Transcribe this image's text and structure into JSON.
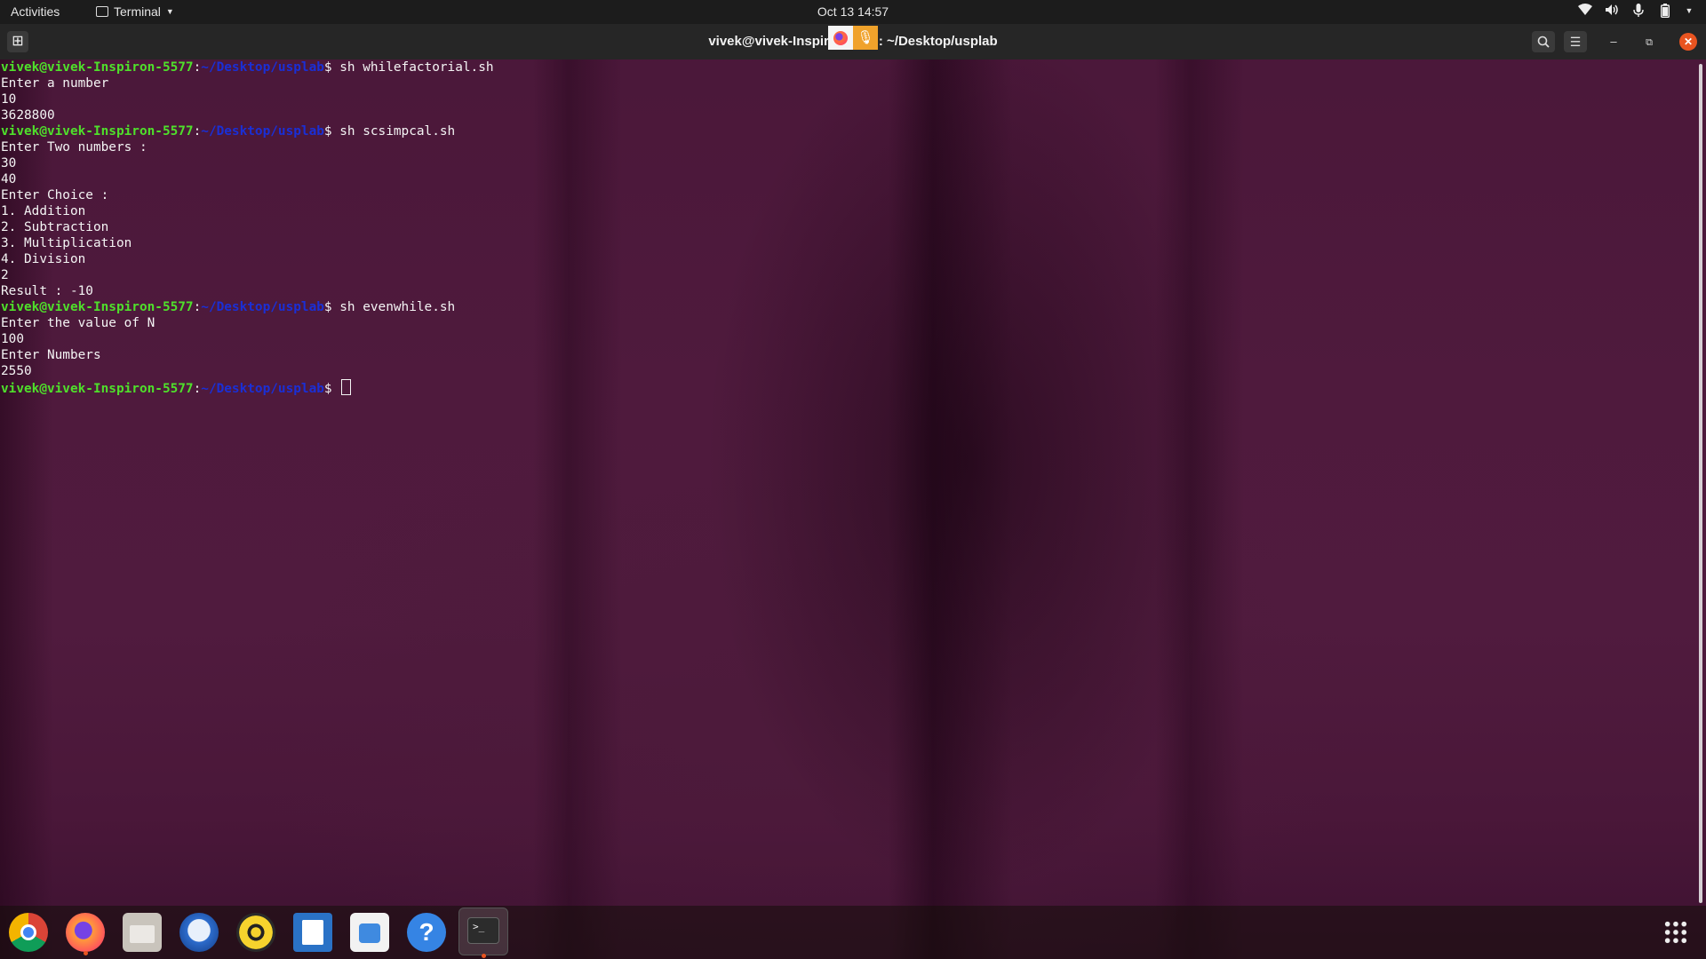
{
  "topbar": {
    "activities": "Activities",
    "app_name": "Terminal",
    "clock": "Oct 13  14:57",
    "tray_icons": [
      "wifi-icon",
      "volume-icon",
      "mic-icon",
      "battery-icon",
      "chevron-down-icon"
    ]
  },
  "window": {
    "title": "vivek@vivek-Inspir",
    "title_suffix": ": ~/Desktop/usplab",
    "accent_close": "#e95420"
  },
  "terminal": {
    "prompt_user": "vivek@vivek-Inspiron-5577",
    "prompt_path": "~/Desktop/usplab",
    "colors": {
      "user": "#4fe02b",
      "path": "#1a2fd6",
      "text": "#f4f4f4"
    },
    "lines": [
      {
        "type": "prompt",
        "cmd": " sh whilefactorial.sh"
      },
      {
        "type": "out",
        "text": "Enter a number"
      },
      {
        "type": "out",
        "text": "10"
      },
      {
        "type": "out",
        "text": "3628800"
      },
      {
        "type": "prompt",
        "cmd": " sh scsimpcal.sh"
      },
      {
        "type": "out",
        "text": "Enter Two numbers :"
      },
      {
        "type": "out",
        "text": "30"
      },
      {
        "type": "out",
        "text": "40"
      },
      {
        "type": "out",
        "text": "Enter Choice :"
      },
      {
        "type": "out",
        "text": "1. Addition"
      },
      {
        "type": "out",
        "text": "2. Subtraction"
      },
      {
        "type": "out",
        "text": "3. Multiplication"
      },
      {
        "type": "out",
        "text": "4. Division"
      },
      {
        "type": "out",
        "text": "2"
      },
      {
        "type": "out",
        "text": "Result : -10"
      },
      {
        "type": "prompt",
        "cmd": " sh evenwhile.sh"
      },
      {
        "type": "out",
        "text": "Enter the value of N"
      },
      {
        "type": "out",
        "text": "100"
      },
      {
        "type": "out",
        "text": "Enter Numbers"
      },
      {
        "type": "out",
        "text": "2550"
      },
      {
        "type": "prompt",
        "cmd": " ",
        "cursor": true
      }
    ]
  },
  "dock": {
    "items": [
      {
        "name": "chrome-icon",
        "cls": "chrome"
      },
      {
        "name": "firefox-icon",
        "cls": "firefox",
        "running": true
      },
      {
        "name": "files-icon",
        "cls": "files"
      },
      {
        "name": "thunderbird-icon",
        "cls": "thunder"
      },
      {
        "name": "rhythmbox-icon",
        "cls": "rhythm"
      },
      {
        "name": "libreoffice-writer-icon",
        "cls": "writer"
      },
      {
        "name": "software-store-icon",
        "cls": "store"
      },
      {
        "name": "help-icon",
        "cls": "help",
        "glyph": "?"
      },
      {
        "name": "terminal-icon",
        "cls": "termicon",
        "glyph": ">_",
        "running": true,
        "active": true
      }
    ]
  }
}
